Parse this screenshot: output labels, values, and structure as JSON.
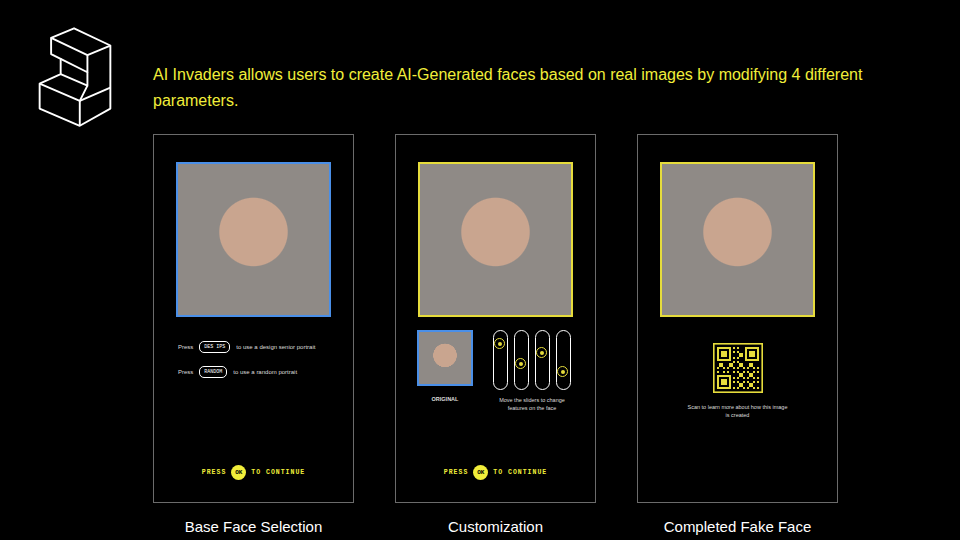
{
  "heading": "AI Invaders allows users to create AI-Generated faces based on real images by modifying 4 different parameters.",
  "screens": [
    {
      "kind": "selection",
      "caption": "Base Face Selection",
      "color": "#4a8fe8",
      "options": [
        {
          "prefix": "Press",
          "key": "DES IPS",
          "text": "to use a design senior portrait"
        },
        {
          "prefix": "Press",
          "key": "RANDOM",
          "text": "to use a random portrait"
        }
      ],
      "continue": {
        "before": "PRESS",
        "key": "OK",
        "after": "TO CONTINUE"
      }
    },
    {
      "kind": "customization",
      "caption": "Customization",
      "color": "#e6dc3c",
      "thumbnail_label": "ORIGINAL",
      "sliders": [
        {
          "level": 0.85
        },
        {
          "level": 0.42
        },
        {
          "level": 0.65
        },
        {
          "level": 0.23
        }
      ],
      "hint": "Move the sliders to change features on the face",
      "continue": {
        "before": "PRESS",
        "key": "OK",
        "after": "TO CONTINUE"
      }
    },
    {
      "kind": "result",
      "caption": "Completed Fake Face",
      "color": "#e6dc3c",
      "qr_hint": "Scan to learn more about how this image is created"
    }
  ]
}
